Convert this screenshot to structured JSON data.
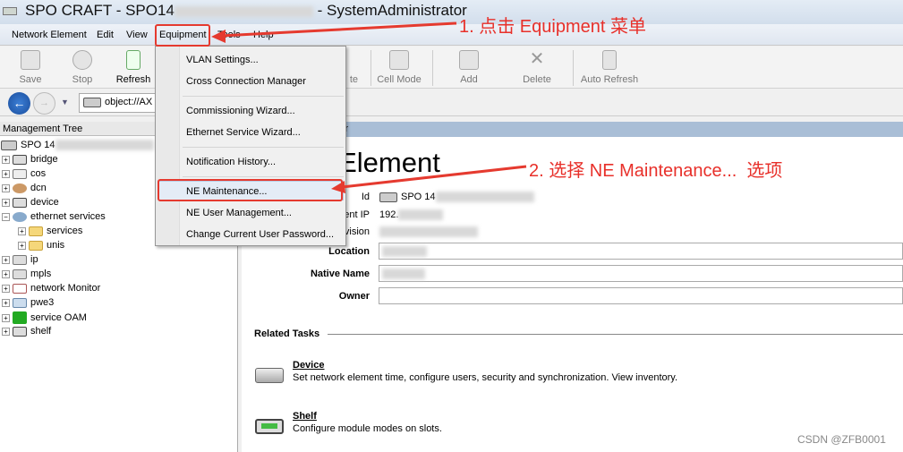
{
  "window": {
    "title_prefix": "SPO CRAFT - SPO14",
    "title_suffix": "- SystemAdministrator"
  },
  "menubar": [
    "Network Element",
    "Edit",
    "View",
    "Equipment",
    "Tools",
    "Help"
  ],
  "toolbar": {
    "save": "Save",
    "stop": "Stop",
    "refresh": "Refresh",
    "partial": "te",
    "cell_mode": "Cell Mode",
    "add": "Add",
    "delete": "Delete",
    "auto_refresh": "Auto Refresh"
  },
  "address": {
    "value": "object://AX"
  },
  "tree": {
    "header": "Management Tree",
    "root": "SPO 14",
    "items": [
      "bridge",
      "cos",
      "dcn",
      "device",
      "ethernet services",
      "services",
      "unis",
      "ip",
      "mpls",
      "network Monitor",
      "pwe3",
      "service OAM",
      "shelf"
    ]
  },
  "browser": {
    "header": "wser",
    "title": "k Element",
    "fields": {
      "id_label": "Id",
      "id_value": "SPO 14",
      "ip_label": "ent IP",
      "ip_value": "192.",
      "rev_label": "vision",
      "location": "Location",
      "native_name": "Native Name",
      "owner": "Owner"
    },
    "related_tasks": "Related Tasks",
    "tasks": [
      {
        "name": "Device",
        "desc": "Set network element time, configure users, security and synchronization. View inventory."
      },
      {
        "name": "Shelf",
        "desc": "Configure module modes on slots."
      }
    ]
  },
  "equipment_menu": [
    "VLAN Settings...",
    "Cross Connection Manager",
    "Commissioning Wizard...",
    "Ethernet Service Wizard...",
    "Notification History...",
    "NE Maintenance...",
    "NE User Management...",
    "Change Current User Password..."
  ],
  "annotations": {
    "step1": "1. 点击 Equipment 菜单",
    "step2": "2. 选择 NE Maintenance...  选项",
    "color": "#e8302a"
  },
  "watermark": "CSDN @ZFB0001"
}
